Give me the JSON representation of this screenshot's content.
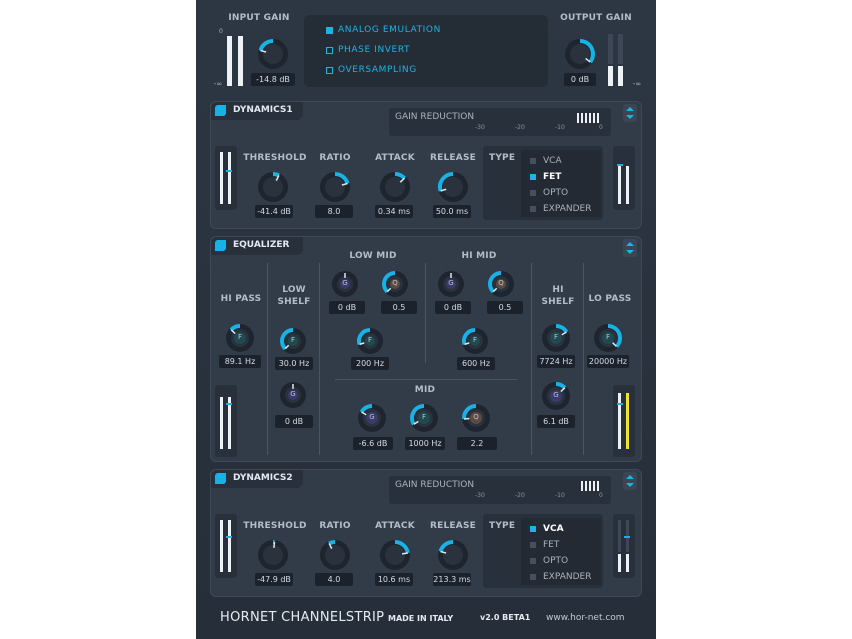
{
  "io": {
    "input_label": "INPUT GAIN",
    "input_value": "-14.8 dB",
    "output_label": "OUTPUT GAIN",
    "output_value": "0 dB",
    "scale_top": "0",
    "scale_bottom": "-∞"
  },
  "options": [
    {
      "label": "ANALOG EMULATION",
      "checked": true
    },
    {
      "label": "PHASE INVERT",
      "checked": false
    },
    {
      "label": "OVERSAMPLING",
      "checked": false
    }
  ],
  "dyn1": {
    "title": "DYNAMICS1",
    "gr_label": "GAIN REDUCTION",
    "gr_scale": [
      "-30",
      "-20",
      "-10",
      "0"
    ],
    "threshold_label": "THRESHOLD",
    "threshold_value": "-41.4 dB",
    "ratio_label": "RATIO",
    "ratio_value": "8.0",
    "attack_label": "ATTACK",
    "attack_value": "0.34 ms",
    "release_label": "RELEASE",
    "release_value": "50.0 ms",
    "type_label": "TYPE",
    "types": [
      "VCA",
      "FET",
      "OPTO",
      "EXPANDER"
    ],
    "selected_type": "FET"
  },
  "eq": {
    "title": "EQUALIZER",
    "hipass_label": "HI PASS",
    "hipass_value": "89.1 Hz",
    "lowshelf_label": "LOW SHELF",
    "lowshelf_freq": "30.0 Hz",
    "lowshelf_gain": "0 dB",
    "lowmid_label": "LOW MID",
    "lowmid_gain": "0 dB",
    "lowmid_q": "0.5",
    "lowmid_freq": "200 Hz",
    "himid_label": "HI MID",
    "himid_gain": "0 dB",
    "himid_q": "0.5",
    "himid_freq": "600 Hz",
    "mid_label": "MID",
    "mid_gain": "-6.6 dB",
    "mid_freq": "1000 Hz",
    "mid_q": "2.2",
    "hishelf_label": "HI SHELF",
    "hishelf_freq": "7724 Hz",
    "hishelf_gain": "6.1 dB",
    "lopass_label": "LO PASS",
    "lopass_value": "20000 Hz",
    "letter_f": "F",
    "letter_g": "G",
    "letter_q": "Q"
  },
  "dyn2": {
    "title": "DYNAMICS2",
    "gr_label": "GAIN REDUCTION",
    "gr_scale": [
      "-30",
      "-20",
      "-10",
      "0"
    ],
    "threshold_label": "THRESHOLD",
    "threshold_value": "-47.9 dB",
    "ratio_label": "RATIO",
    "ratio_value": "4.0",
    "attack_label": "ATTACK",
    "attack_value": "10.6 ms",
    "release_label": "RELEASE",
    "release_value": "213.3 ms",
    "type_label": "TYPE",
    "types": [
      "VCA",
      "FET",
      "OPTO",
      "EXPANDER"
    ],
    "selected_type": "VCA"
  },
  "footer": {
    "product": "HORNET CHANNELSTRIP",
    "made": "MADE IN ITALY",
    "version": "v2.0 BETA1",
    "url": "www.hor-net.com"
  },
  "colors": {
    "accent": "#18b3e6",
    "panel": "#323c49",
    "bg": "#2a323e"
  }
}
